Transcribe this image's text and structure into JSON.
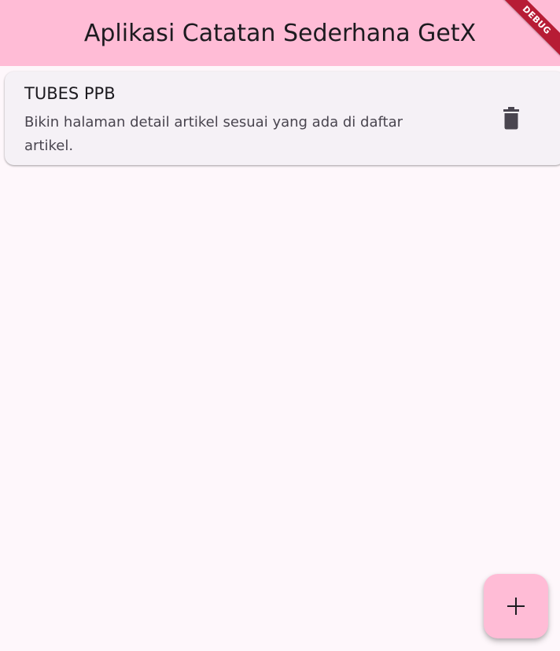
{
  "app_bar": {
    "title": "Aplikasi Catatan Sederhana GetX",
    "background": "#ffbcd6"
  },
  "debug_banner": {
    "label": "DEBUG",
    "color": "#b71c35"
  },
  "notes": [
    {
      "title": "TUBES PPB",
      "body": "Bikin halaman detail artikel sesuai yang ada di daftar artikel.",
      "action_icon": "trash-icon"
    }
  ],
  "fab": {
    "icon": "plus-icon",
    "background": "#ffbcd6"
  }
}
